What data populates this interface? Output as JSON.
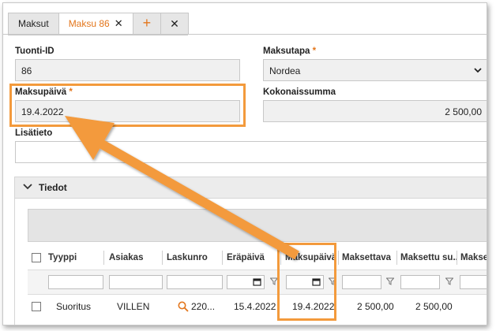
{
  "tabs": [
    {
      "label": "Maksut",
      "active": false
    },
    {
      "label": "Maksu 86",
      "active": true,
      "close": "✕"
    }
  ],
  "tab_add": "+",
  "tab_close": "✕",
  "form": {
    "tuonti_label": "Tuonti-ID",
    "tuonti_value": "86",
    "maksutapa_label": "Maksutapa",
    "maksutapa_value": "Nordea",
    "maksupaiva_label": "Maksupäivä",
    "maksupaiva_value": "19.4.2022",
    "kokonaissumma_label": "Kokonaissumma",
    "kokonaissumma_value": "2 500,00",
    "lisatieto_label": "Lisätieto",
    "lisatieto_value": "",
    "required_mark": "*"
  },
  "panel": {
    "title": "Tiedot"
  },
  "grid": {
    "columns": [
      "Tyyppi",
      "Asiakas",
      "Laskunro",
      "Eräpäivä",
      "Maksupäivä",
      "Maksettava",
      "Maksettu su...",
      "Maksett"
    ],
    "rows": [
      {
        "tyyppi": "Suoritus",
        "asiakas": "VILLEN",
        "laskunro": "220...",
        "erapaiva": "15.4.2022",
        "maksupaiva": "19.4.2022",
        "maksettava": "2 500,00",
        "maksettu": "2 500,00"
      }
    ]
  },
  "colors": {
    "accent": "#e3761c",
    "highlight": "#f39a3c"
  }
}
